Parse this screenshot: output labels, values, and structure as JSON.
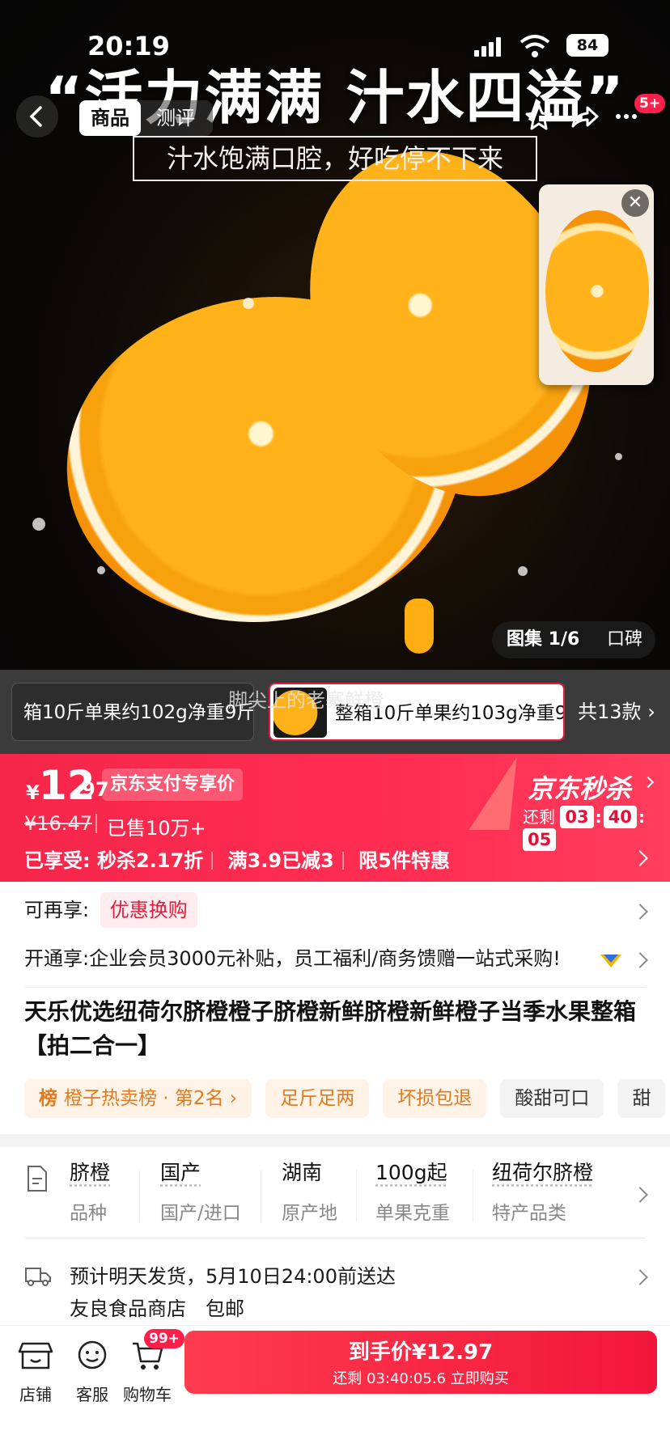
{
  "status_bar": {
    "time": "20:19",
    "battery": "84"
  },
  "hero": {
    "banner": "“活力满满 汁水四溢”",
    "subtitle": "汁水饱满口腔，好吃停不下来",
    "tabs": [
      "商品",
      "测评"
    ],
    "more_badge": "5+",
    "gallery_label": "图集 1/6",
    "review_label": "口碑"
  },
  "variants": {
    "items": [
      "箱10斤单果约102g净重9斤",
      "整箱10斤单果约103g净重9"
    ],
    "total": "共13款",
    "caption": "脚尖上的老寨鲜橙"
  },
  "price": {
    "currency": "¥",
    "integer": "12",
    "decimal": ".97",
    "pay_tag": "京东支付专享价",
    "original": "¥16.47",
    "sold": "已售10万+",
    "perks_label": "已享受:",
    "perks": [
      "秒杀2.17折",
      "满3.9已减3",
      "限5件特惠"
    ],
    "seckill": "京东秒杀",
    "countdown_label": "还剩",
    "countdown": [
      "03",
      "40",
      "05"
    ]
  },
  "info": {
    "enjoy_label": "可再享:",
    "enjoy_value": "优惠换购",
    "open_text": "开通享:企业会员3000元补贴，员工福利/商务馈赠一站式采购!",
    "title": "天乐优选纽荷尔脐橙橙子脐橙新鲜脐橙新鲜橙子当季水果整箱【拍二合一】",
    "chips": [
      "橙子热卖榜 · 第2名",
      "足斤足两",
      "坏损包退",
      "酸甜可口",
      "甜"
    ]
  },
  "specs": [
    {
      "value": "脐橙",
      "key": "品种"
    },
    {
      "value": "国产",
      "key": "国产/进口"
    },
    {
      "value": "湖南",
      "key": "原产地"
    },
    {
      "value": "100g起",
      "key": "单果克重"
    },
    {
      "value": "纽荷尔脐橙",
      "key": "特产品类"
    }
  ],
  "shipping": {
    "line1": "预计明天发货，5月10日24:00前送达",
    "line2": "友良食品商店　包邮"
  },
  "bottom": {
    "store": "店铺",
    "service": "客服",
    "cart": "购物车",
    "cart_badge": "99+",
    "buy_line1": "到手价¥12.97",
    "buy_line2": "还剩 03:40:05.6 立即购买"
  },
  "colors": {
    "accent": "#f2163b",
    "orange_tag": "#e07a1f"
  }
}
